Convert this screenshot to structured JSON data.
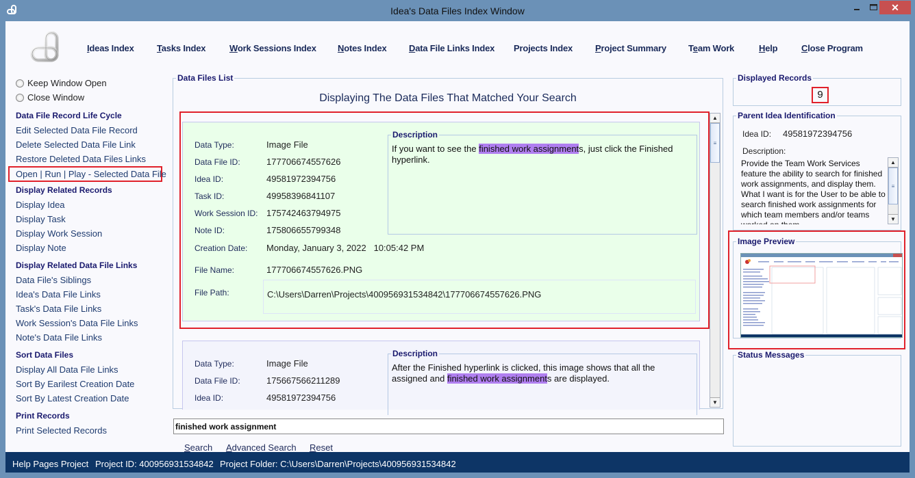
{
  "window": {
    "title": "Idea's Data Files Index Window",
    "minimize_glyph": "—",
    "maximize_glyph": "☐",
    "close_glyph": "✕"
  },
  "menu": [
    {
      "label": "Ideas Index",
      "accel": "I",
      "rest": "deas Index"
    },
    {
      "label": "Tasks Index",
      "accel": "T",
      "rest": "asks Index"
    },
    {
      "label": "Work Sessions Index",
      "accel": "W",
      "rest": "ork Sessions Index"
    },
    {
      "label": "Notes Index",
      "accel": "N",
      "rest": "otes Index"
    },
    {
      "label": "Data File Links Index",
      "accel": "D",
      "rest": "ata File Links Index"
    },
    {
      "label": "Projects Index",
      "accel": "",
      "rest": "Projects Index"
    },
    {
      "label": "Project Summary",
      "accel": "P",
      "rest": "roject Summary"
    },
    {
      "label": "Team Work",
      "accel": "T",
      "pre": "",
      "rest": "eam Work",
      "full": "Team Work"
    },
    {
      "label": "Help",
      "accel": "H",
      "rest": "elp"
    },
    {
      "label": "Close Program",
      "accel": "C",
      "rest": "lose Program"
    }
  ],
  "left": {
    "radios": [
      {
        "label": "Keep Window Open",
        "checked": false
      },
      {
        "label": "Close Window",
        "checked": false
      }
    ],
    "sections": [
      {
        "title": "Data File Record Life Cycle",
        "items": [
          "Edit Selected Data File Record",
          "Delete Selected Data File Link",
          "Restore Deleted Data Files Links",
          "Open | Run | Play - Selected Data File"
        ]
      },
      {
        "title": "Display Related Records",
        "items": [
          "Display Idea",
          "Display Task",
          "Display Work Session",
          "Display Note"
        ]
      },
      {
        "title": "Display Related Data File Links",
        "items": [
          "Data File's Siblings",
          "Idea's Data File Links",
          "Task's Data File Links",
          "Work Session's Data File Links",
          "Note's Data File Links"
        ]
      },
      {
        "title": "Sort Data Files",
        "items": [
          "Display All Data File Links",
          "Sort By Earilest Creation Date",
          "Sort By Latest Creation Date"
        ]
      },
      {
        "title": "Print Records",
        "items": [
          "Print Selected Records"
        ]
      }
    ]
  },
  "list": {
    "legend": "Data Files List",
    "title": "Displaying The Data Files That Matched Your Search",
    "labels": {
      "data_type": "Data Type:",
      "data_file_id": "Data File ID:",
      "idea_id": "Idea ID:",
      "task_id": "Task ID:",
      "work_session_id": "Work Session ID:",
      "note_id": "Note ID:",
      "creation_date": "Creation Date:",
      "file_name": "File Name:",
      "file_path": "File Path:",
      "description": "Description"
    },
    "records": [
      {
        "data_type": "Image File",
        "data_file_id": "177706674557626",
        "idea_id": "49581972394756",
        "task_id": "49958396841107",
        "work_session_id": "175742463794975",
        "note_id": "175806655799348",
        "creation_date": "Monday, January 3, 2022   10:05:42 PM",
        "file_name": "177706674557626.PNG",
        "file_path": "C:\\Users\\Darren\\Projects\\400956931534842\\177706674557626.PNG",
        "desc_before": "If you want to see the ",
        "desc_highlight": "finished work assignment",
        "desc_after": "s, just click the Finished hyperlink."
      },
      {
        "data_type": "Image File",
        "data_file_id": "175667566211289",
        "idea_id": "49581972394756",
        "desc_before": "After the Finished hyperlink is clicked, this image shows that all the assigned and ",
        "desc_highlight": "finished work assignment",
        "desc_after": "s are displayed."
      }
    ]
  },
  "search": {
    "value": "finished work assignment",
    "buttons": [
      {
        "label": "Search",
        "accel": "S",
        "rest": "earch"
      },
      {
        "label": "Advanced Search",
        "accel": "A",
        "rest": "dvanced Search"
      },
      {
        "label": "Reset",
        "accel": "R",
        "rest": "eset"
      }
    ]
  },
  "right": {
    "displayed_records_legend": "Displayed Records",
    "displayed_records_count": "9",
    "parent_legend": "Parent Idea Identification",
    "idea_id_label": "Idea ID:",
    "idea_id": "49581972394756",
    "description_label": "Description:",
    "description": "Provide the Team Work Services feature the ability to search for finished work assignments, and display them. What I want is for the User to be able to search finished work assignments for which team members and/or teams worked on them.",
    "image_preview_legend": "Image Preview",
    "status_legend": "Status Messages"
  },
  "statusbar": {
    "project_name": "Help Pages Project",
    "project_id": "Project ID:  400956931534842",
    "project_folder": "Project Folder: C:\\Users\\Darren\\Projects\\400956931534842"
  },
  "colors": {
    "frame": "#6b91b7",
    "statusbar": "#0d3566",
    "highlight": "#b07ff0",
    "selection_outline": "#e0202a",
    "record_bg": "#eaffea"
  }
}
